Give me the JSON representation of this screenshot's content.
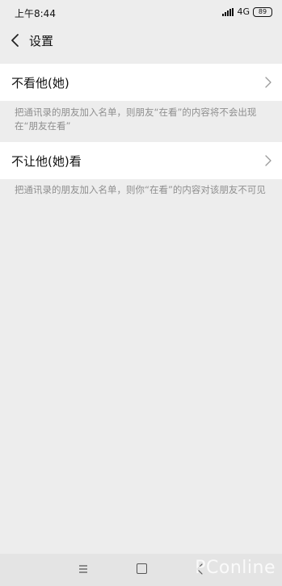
{
  "status_bar": {
    "time": "上午8:44",
    "network": "4G",
    "battery": "89"
  },
  "header": {
    "title": "设置"
  },
  "settings": [
    {
      "label": "不看他(她)",
      "description": "把通讯录的朋友加入名单，则朋友“在看”的内容将不会出现在“朋友在看”"
    },
    {
      "label": "不让他(她)看",
      "description": "把通讯录的朋友加入名单，则你“在看”的内容对该朋友不可见"
    }
  ],
  "watermark": "PConline"
}
